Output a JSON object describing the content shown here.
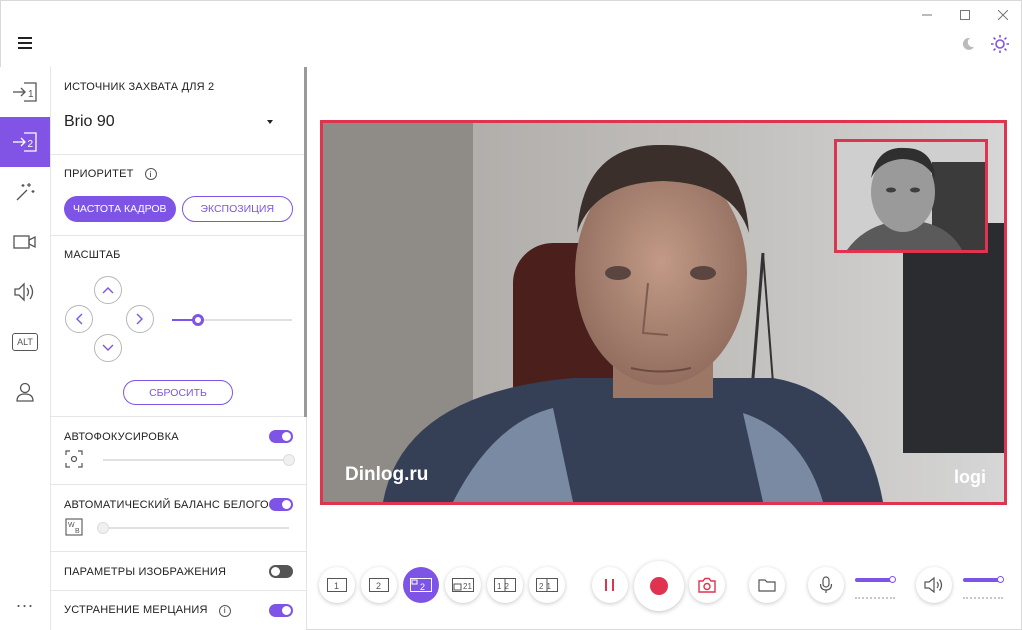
{
  "window": {
    "controls": [
      "minimize",
      "maximize",
      "close"
    ]
  },
  "theme": {
    "dark_icon": "moon-icon",
    "light_icon": "sun-icon"
  },
  "rail": {
    "items": [
      {
        "name": "source-1",
        "icon": "input-1-icon",
        "active": false
      },
      {
        "name": "source-2",
        "icon": "input-2-icon",
        "active": true
      },
      {
        "name": "effects",
        "icon": "magic-wand-icon",
        "active": false
      },
      {
        "name": "camera",
        "icon": "video-camera-icon",
        "active": false
      },
      {
        "name": "audio",
        "icon": "speaker-icon",
        "active": false
      },
      {
        "name": "alt",
        "icon": "alt-key-icon",
        "label": "ALT",
        "active": false
      },
      {
        "name": "account",
        "icon": "user-icon",
        "active": false
      }
    ],
    "more": "..."
  },
  "panel": {
    "source": {
      "label": "ИСТОЧНИК ЗАХВАТА ДЛЯ 2",
      "value": "Brio 90"
    },
    "priority": {
      "label": "ПРИОРИТЕТ",
      "option_1": "ЧАСТОТА КАДРОВ",
      "option_2": "ЭКСПОЗИЦИЯ",
      "selected": "ЧАСТОТА КАДРОВ"
    },
    "zoom": {
      "label": "МАСШТАБ",
      "level": 0.22,
      "reset_label": "СБРОСИТЬ"
    },
    "autofocus": {
      "label": "АВТОФОКУСИРОВКА",
      "enabled": true,
      "level": 1.0
    },
    "white_balance": {
      "label": "АВТОМАТИЧЕСКИЙ БАЛАНС БЕЛОГО",
      "enabled": true,
      "level": 0.0
    },
    "image_params": {
      "label": "ПАРАМЕТРЫ ИЗОБРАЖЕНИЯ",
      "enabled": false
    },
    "flicker": {
      "label": "УСТРАНЕНИЕ МЕРЦАНИЯ",
      "enabled": true
    }
  },
  "preview": {
    "watermark_left": "Dinlog.ru",
    "watermark_right": "logi",
    "border_color": "#e0334f"
  },
  "toolbar": {
    "layouts": [
      {
        "name": "layout-1",
        "label": "1",
        "active": false
      },
      {
        "name": "layout-2",
        "label": "2",
        "active": false
      },
      {
        "name": "layout-pip-2",
        "label": "2",
        "active": true
      },
      {
        "name": "layout-pip-21",
        "label": "21",
        "active": false
      },
      {
        "name": "layout-split-12",
        "label": "12",
        "active": false
      },
      {
        "name": "layout-split-21",
        "label": "21",
        "active": false
      }
    ],
    "mic_level": 0.95,
    "speaker_level": 0.95
  },
  "colors": {
    "accent": "#7e54e6",
    "record": "#e0334f"
  }
}
